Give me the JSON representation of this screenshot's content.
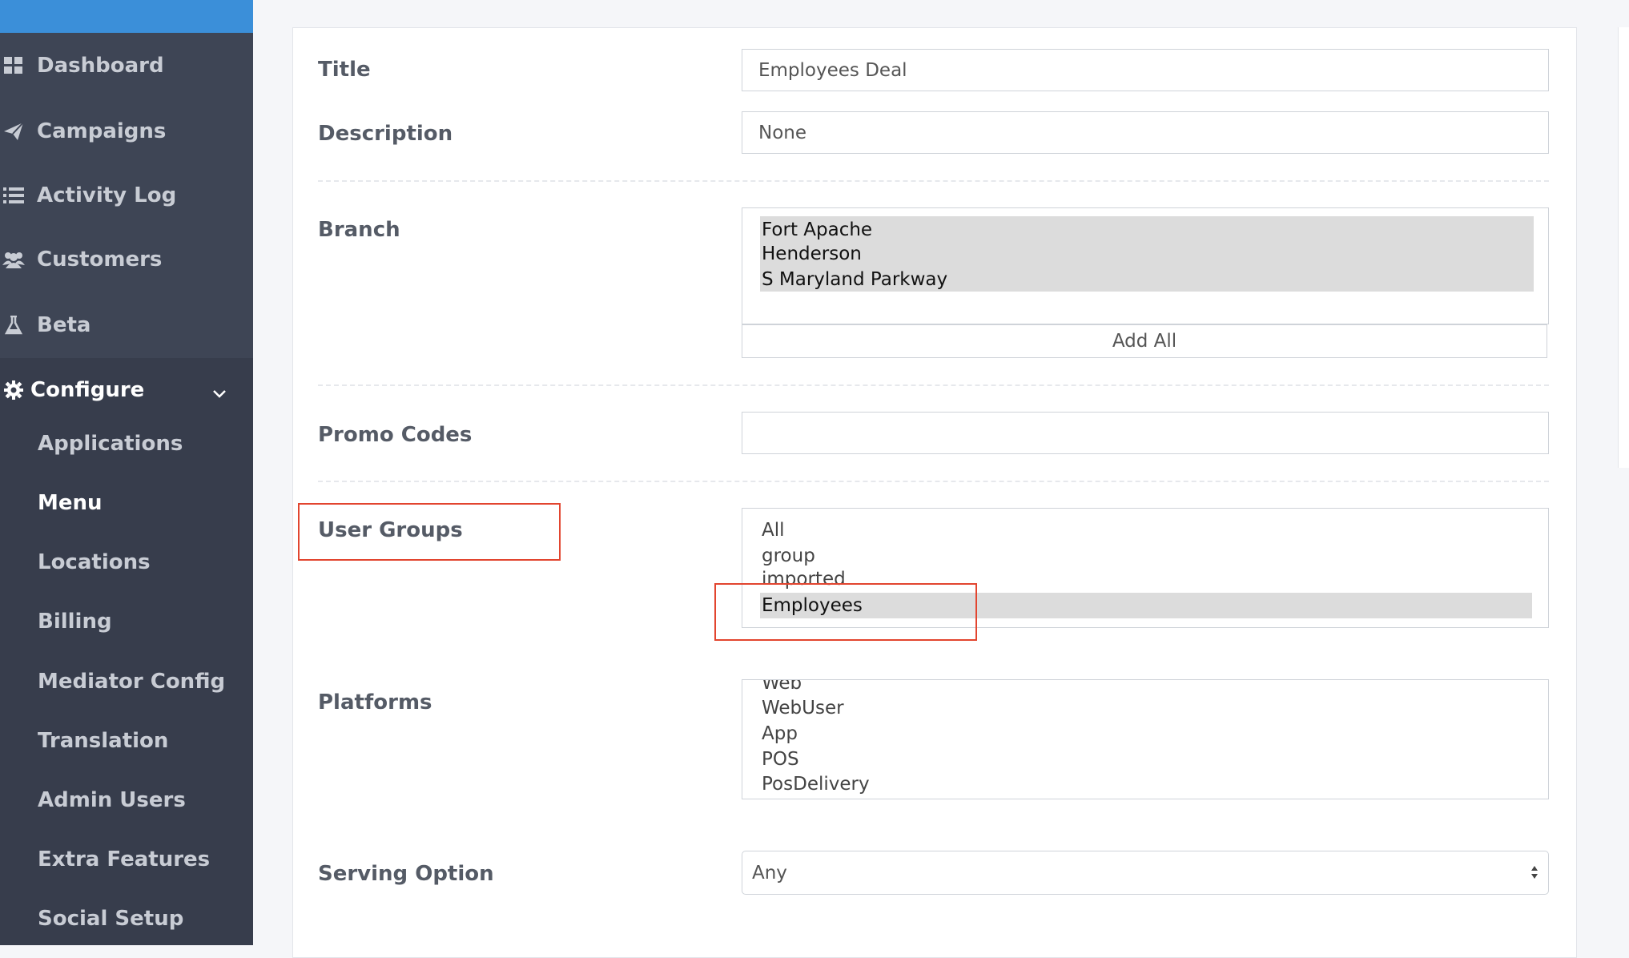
{
  "sidebar": {
    "items": [
      {
        "label": "Dashboard",
        "icon": "dashboard-icon"
      },
      {
        "label": "Campaigns",
        "icon": "paper-plane-icon"
      },
      {
        "label": "Activity Log",
        "icon": "list-icon"
      },
      {
        "label": "Customers",
        "icon": "users-icon"
      },
      {
        "label": "Beta",
        "icon": "flask-icon"
      }
    ],
    "configure": {
      "label": "Configure",
      "icon": "gear-icon",
      "sub_items": [
        "Applications",
        "Menu",
        "Locations",
        "Billing",
        "Mediator Config",
        "Translation",
        "Admin Users",
        "Extra Features",
        "Social Setup"
      ],
      "current": "Menu"
    }
  },
  "form": {
    "title": {
      "label": "Title",
      "value": "Employees Deal"
    },
    "description": {
      "label": "Description",
      "value": "None"
    },
    "branch": {
      "label": "Branch",
      "options": [
        "Fort Apache",
        "Henderson",
        "S Maryland Parkway"
      ],
      "add_all_label": "Add All"
    },
    "promo_codes": {
      "label": "Promo Codes",
      "value": ""
    },
    "user_groups": {
      "label": "User Groups",
      "options": [
        "All",
        "group",
        "imported",
        "Employees"
      ],
      "selected": "Employees"
    },
    "platforms": {
      "label": "Platforms",
      "options": [
        "Web",
        "WebUser",
        "App",
        "POS",
        "PosDelivery"
      ]
    },
    "serving_option": {
      "label": "Serving Option",
      "value": "Any"
    }
  },
  "colors": {
    "sidebar_bg": "#3e4555",
    "accent": "#3b8fd9",
    "highlight": "#e2452f"
  }
}
